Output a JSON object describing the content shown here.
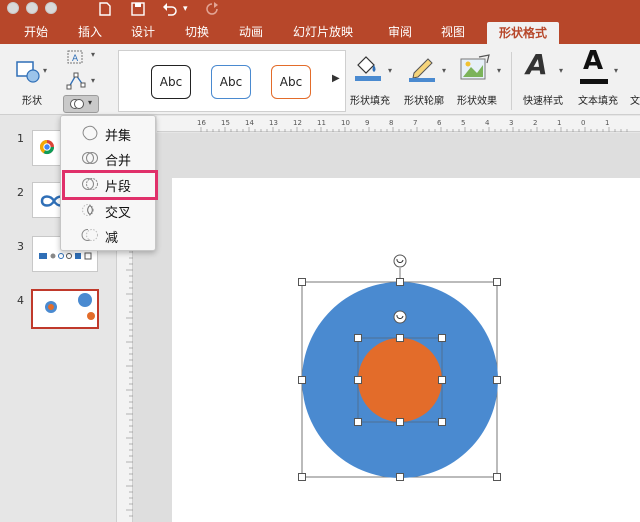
{
  "window": {
    "buttons": [
      "close",
      "minimize",
      "zoom"
    ],
    "quick_access": {
      "undo_caret": "▾",
      "more": "▾"
    }
  },
  "tabs": [
    {
      "label": "开始"
    },
    {
      "label": "插入"
    },
    {
      "label": "设计"
    },
    {
      "label": "切换"
    },
    {
      "label": "动画"
    },
    {
      "label": "幻灯片放映"
    },
    {
      "label": "审阅"
    },
    {
      "label": "视图"
    },
    {
      "label": "形状格式",
      "active": true
    }
  ],
  "ribbon": {
    "shape_label": "形状",
    "style_samples": [
      "Abc",
      "Abc",
      "Abc"
    ],
    "gallery_next": "▶",
    "fill_label": "形状填充",
    "outline_label": "形状轮廓",
    "effects_label": "形状效果",
    "quick_style_label": "快速样式",
    "text_fill_label": "文本填充",
    "text_fill_glyph": "A",
    "quick_style_glyph": "A",
    "cut_label": "文"
  },
  "merge_menu": {
    "items": [
      {
        "label": "并集",
        "icon": "union-icon"
      },
      {
        "label": "合并",
        "icon": "combine-icon"
      },
      {
        "label": "片段",
        "icon": "fragment-icon",
        "highlighted": true
      },
      {
        "label": "交叉",
        "icon": "intersect-icon"
      },
      {
        "label": "减",
        "icon": "subtract-icon"
      }
    ]
  },
  "slides": [
    {
      "number": "1"
    },
    {
      "number": "2"
    },
    {
      "number": "3"
    },
    {
      "number": "4",
      "selected": true
    }
  ],
  "ruler": {
    "ticks": [
      "16",
      "15",
      "14",
      "13",
      "12",
      "11",
      "10",
      "9",
      "8",
      "7",
      "6",
      "5",
      "4",
      "3",
      "2",
      "1",
      "0",
      "1"
    ]
  },
  "colors": {
    "brand": "#b7472a",
    "outer_circle": "#4a8ad0",
    "inner_circle": "#e36c2a",
    "highlight": "#e0306a"
  }
}
